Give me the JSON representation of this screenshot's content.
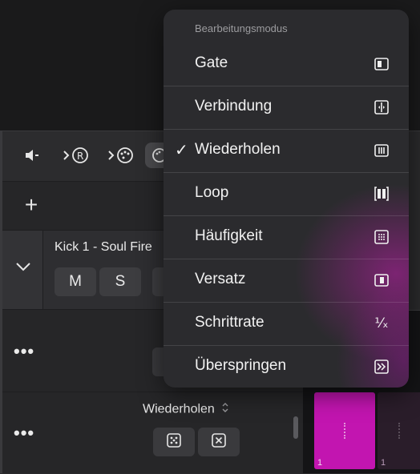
{
  "menu": {
    "header": "Bearbeitungsmodus",
    "items": [
      {
        "label": "Gate",
        "icon": "gate-icon",
        "checked": false
      },
      {
        "label": "Verbindung",
        "icon": "tie-icon",
        "checked": false
      },
      {
        "label": "Wiederholen",
        "icon": "repeat-icon",
        "checked": true
      },
      {
        "label": "Loop",
        "icon": "loop-icon",
        "checked": false
      },
      {
        "label": "Häufigkeit",
        "icon": "probability-icon",
        "checked": false
      },
      {
        "label": "Versatz",
        "icon": "offset-icon",
        "checked": false
      },
      {
        "label": "Schrittrate",
        "icon": "step-rate-icon",
        "checked": false
      },
      {
        "label": "Überspringen",
        "icon": "skip-icon",
        "checked": false
      }
    ],
    "check_mark": "✓",
    "step_rate_glyph": "⅟ₓ"
  },
  "toolbar": {
    "icons": [
      "speaker-icon",
      "midi-record-icon",
      "midi-palette-icon",
      "palette-icon"
    ]
  },
  "add_button": "+",
  "track": {
    "name": "Kick 1 - Soul Fire",
    "mute_label": "M",
    "solo_label": "S"
  },
  "rows": {
    "more_label": "•••",
    "mode_label": "Wiederholen",
    "mode_chevron": "⌃"
  },
  "steps": [
    {
      "number": "1",
      "color": "#c215b0"
    },
    {
      "number": "1",
      "color": "#2a1d2a"
    }
  ]
}
